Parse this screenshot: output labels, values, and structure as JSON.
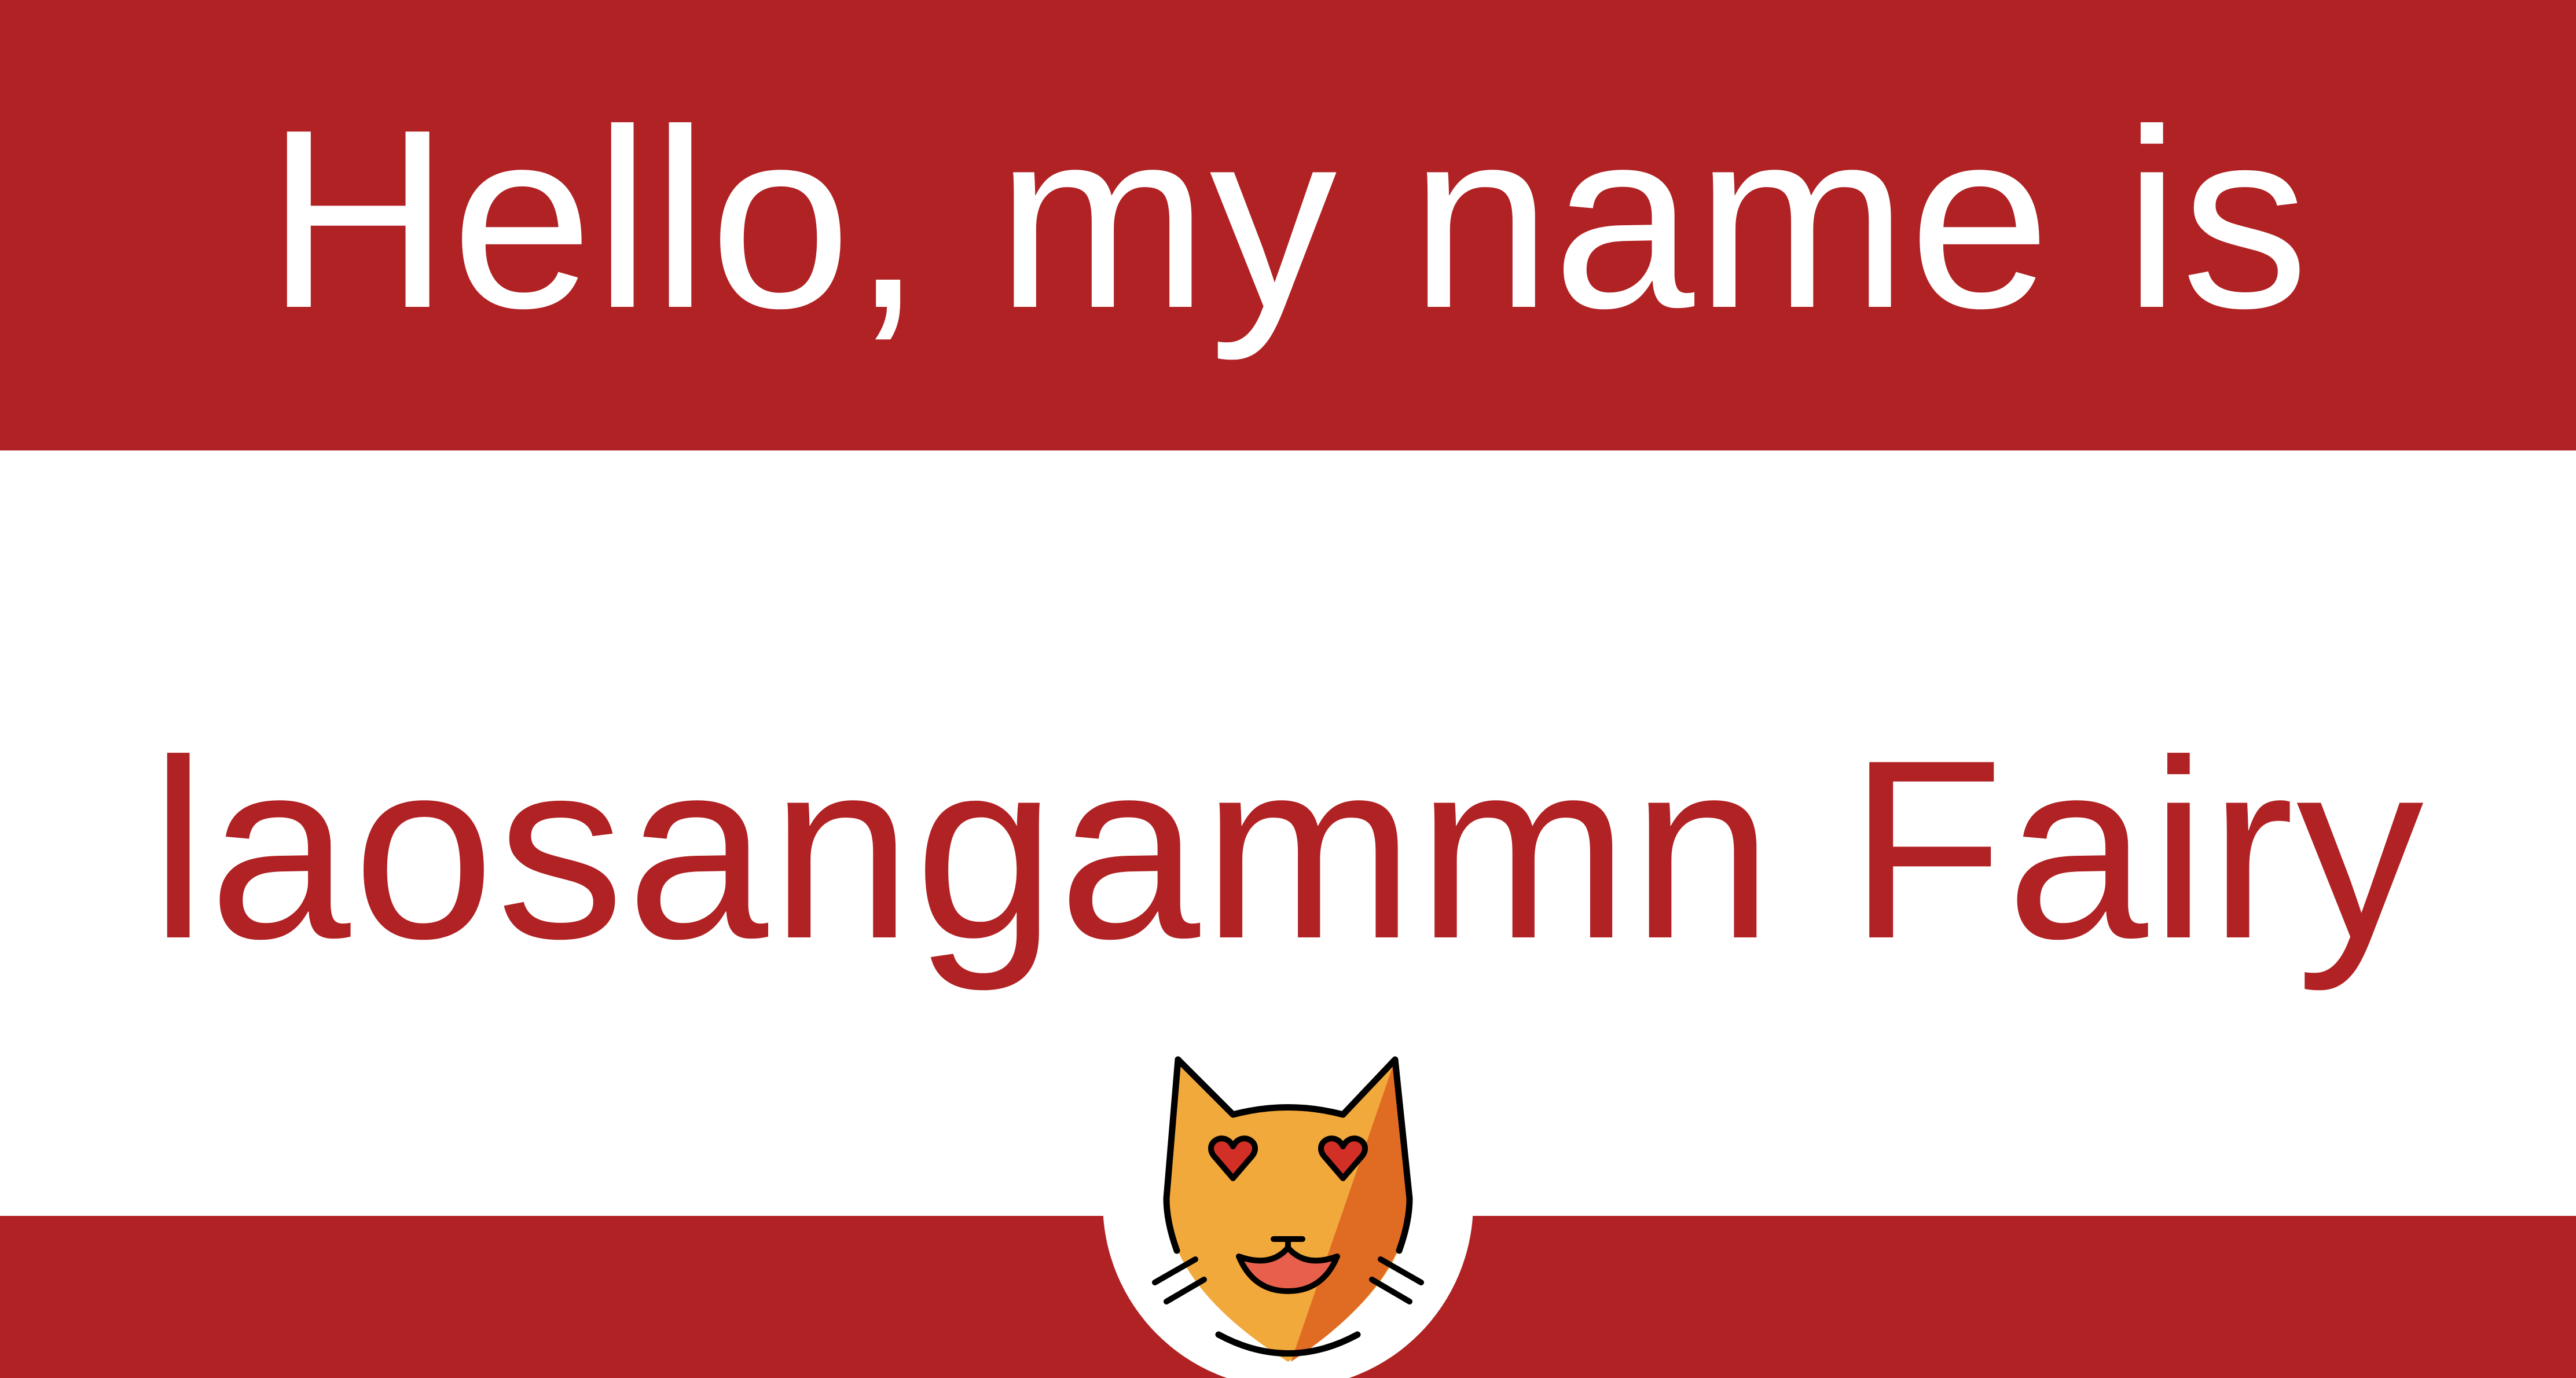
{
  "badge": {
    "greeting": "Hello, my name is",
    "name": "laosangammn Fairy",
    "emoji_icon": "smiling-cat-with-heart-eyes-icon"
  },
  "colors": {
    "band": "#b12224",
    "background": "#ffffff",
    "greeting_text": "#ffffff",
    "name_text": "#b12224",
    "cat_fur": "#f2a93c",
    "cat_shade": "#e06c24",
    "hearts": "#d22f27",
    "tongue": "#e8604c"
  }
}
